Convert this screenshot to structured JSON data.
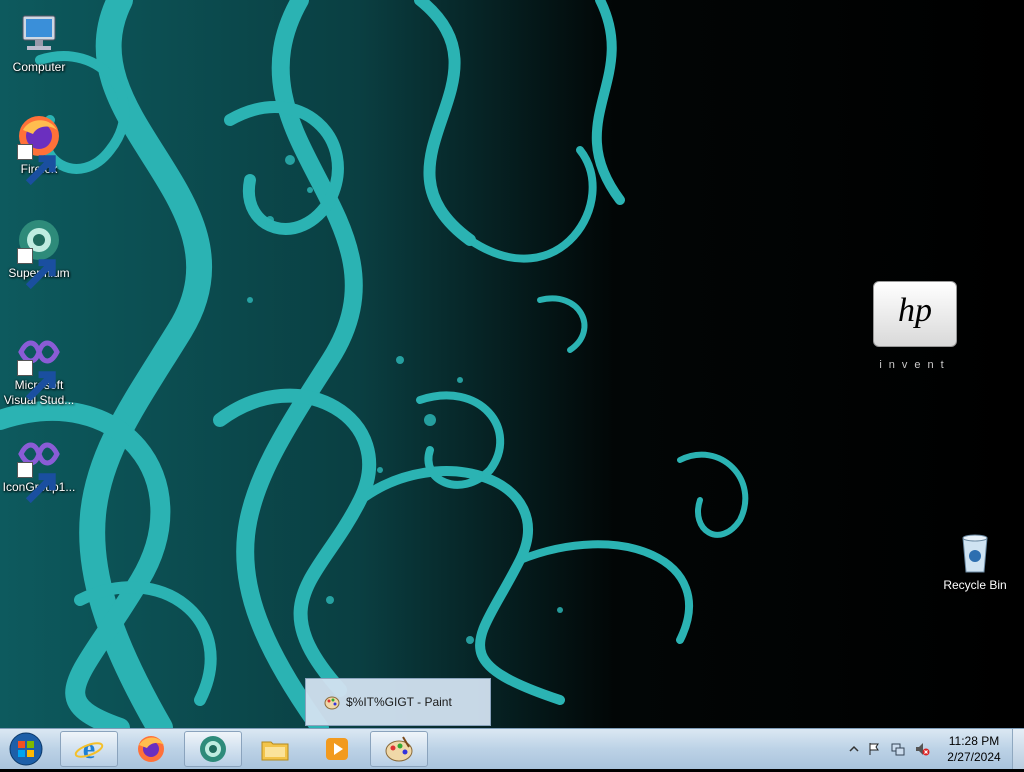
{
  "desktop": {
    "icons": [
      {
        "label": "Computer"
      },
      {
        "label": "Firefox"
      },
      {
        "label": "Supermium"
      },
      {
        "label": "Microsoft Visual Stud..."
      },
      {
        "label": "IconGroup1..."
      },
      {
        "label": "Recycle Bin"
      }
    ],
    "wallpaper_logo": {
      "brand": "hp",
      "tagline": "invent"
    }
  },
  "thumbnail_popup": {
    "title": "$%IT%GIGT - Paint"
  },
  "taskbar": {
    "buttons": [
      {
        "name": "Internet Explorer"
      },
      {
        "name": "Firefox"
      },
      {
        "name": "Supermium"
      },
      {
        "name": "File Explorer"
      },
      {
        "name": "Media Player"
      },
      {
        "name": "Paint"
      }
    ],
    "clock": {
      "time": "11:28 PM",
      "date": "2/27/2024"
    }
  },
  "colors": {
    "teal": "#2bb3b3",
    "taskbar": "#bcd2e6"
  }
}
